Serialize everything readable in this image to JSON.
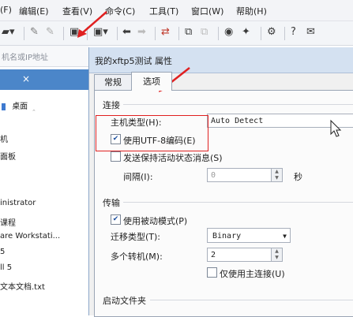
{
  "menubar": {
    "items": [
      "(F)",
      "编辑(E)",
      "查看(V)",
      "命令(C)",
      "工具(T)",
      "窗口(W)",
      "帮助(H)"
    ]
  },
  "address": {
    "placeholder": "机名或IP地址"
  },
  "sidebar": {
    "tab_close": "×",
    "items": [
      "桌面",
      "机",
      "面板",
      "inistrator",
      "课程",
      "are Workstati...",
      "5",
      "ll 5",
      "文本文档.txt"
    ]
  },
  "dialog": {
    "title": "我的xftp5测试 属性",
    "tabs": [
      "常规",
      "选项"
    ],
    "active_tab": "选项",
    "connection": {
      "group_label": "连接",
      "host_type_label": "主机类型(H):",
      "host_type_value": "Auto Detect",
      "utf8_label": "使用UTF-8编码(E)",
      "utf8_checked": true,
      "keepalive_label": "发送保持活动状态消息(S)",
      "keepalive_checked": false,
      "interval_label": "间隔(I):",
      "interval_value": "0",
      "interval_unit": "秒"
    },
    "transfer": {
      "group_label": "传输",
      "passive_label": "使用被动模式(P)",
      "passive_checked": true,
      "transfer_type_label": "迁移类型(T):",
      "transfer_type_value": "Binary",
      "multi_transfer_label": "多个转机(M):",
      "multi_transfer_value": "2",
      "main_only_label": "仅使用主连接(U)",
      "main_only_checked": false
    },
    "startup": {
      "group_label": "启动文件夹"
    }
  },
  "colors": {
    "highlight": "#e02020",
    "arrow": "#e02020",
    "panel_header": "#4b86c9"
  }
}
